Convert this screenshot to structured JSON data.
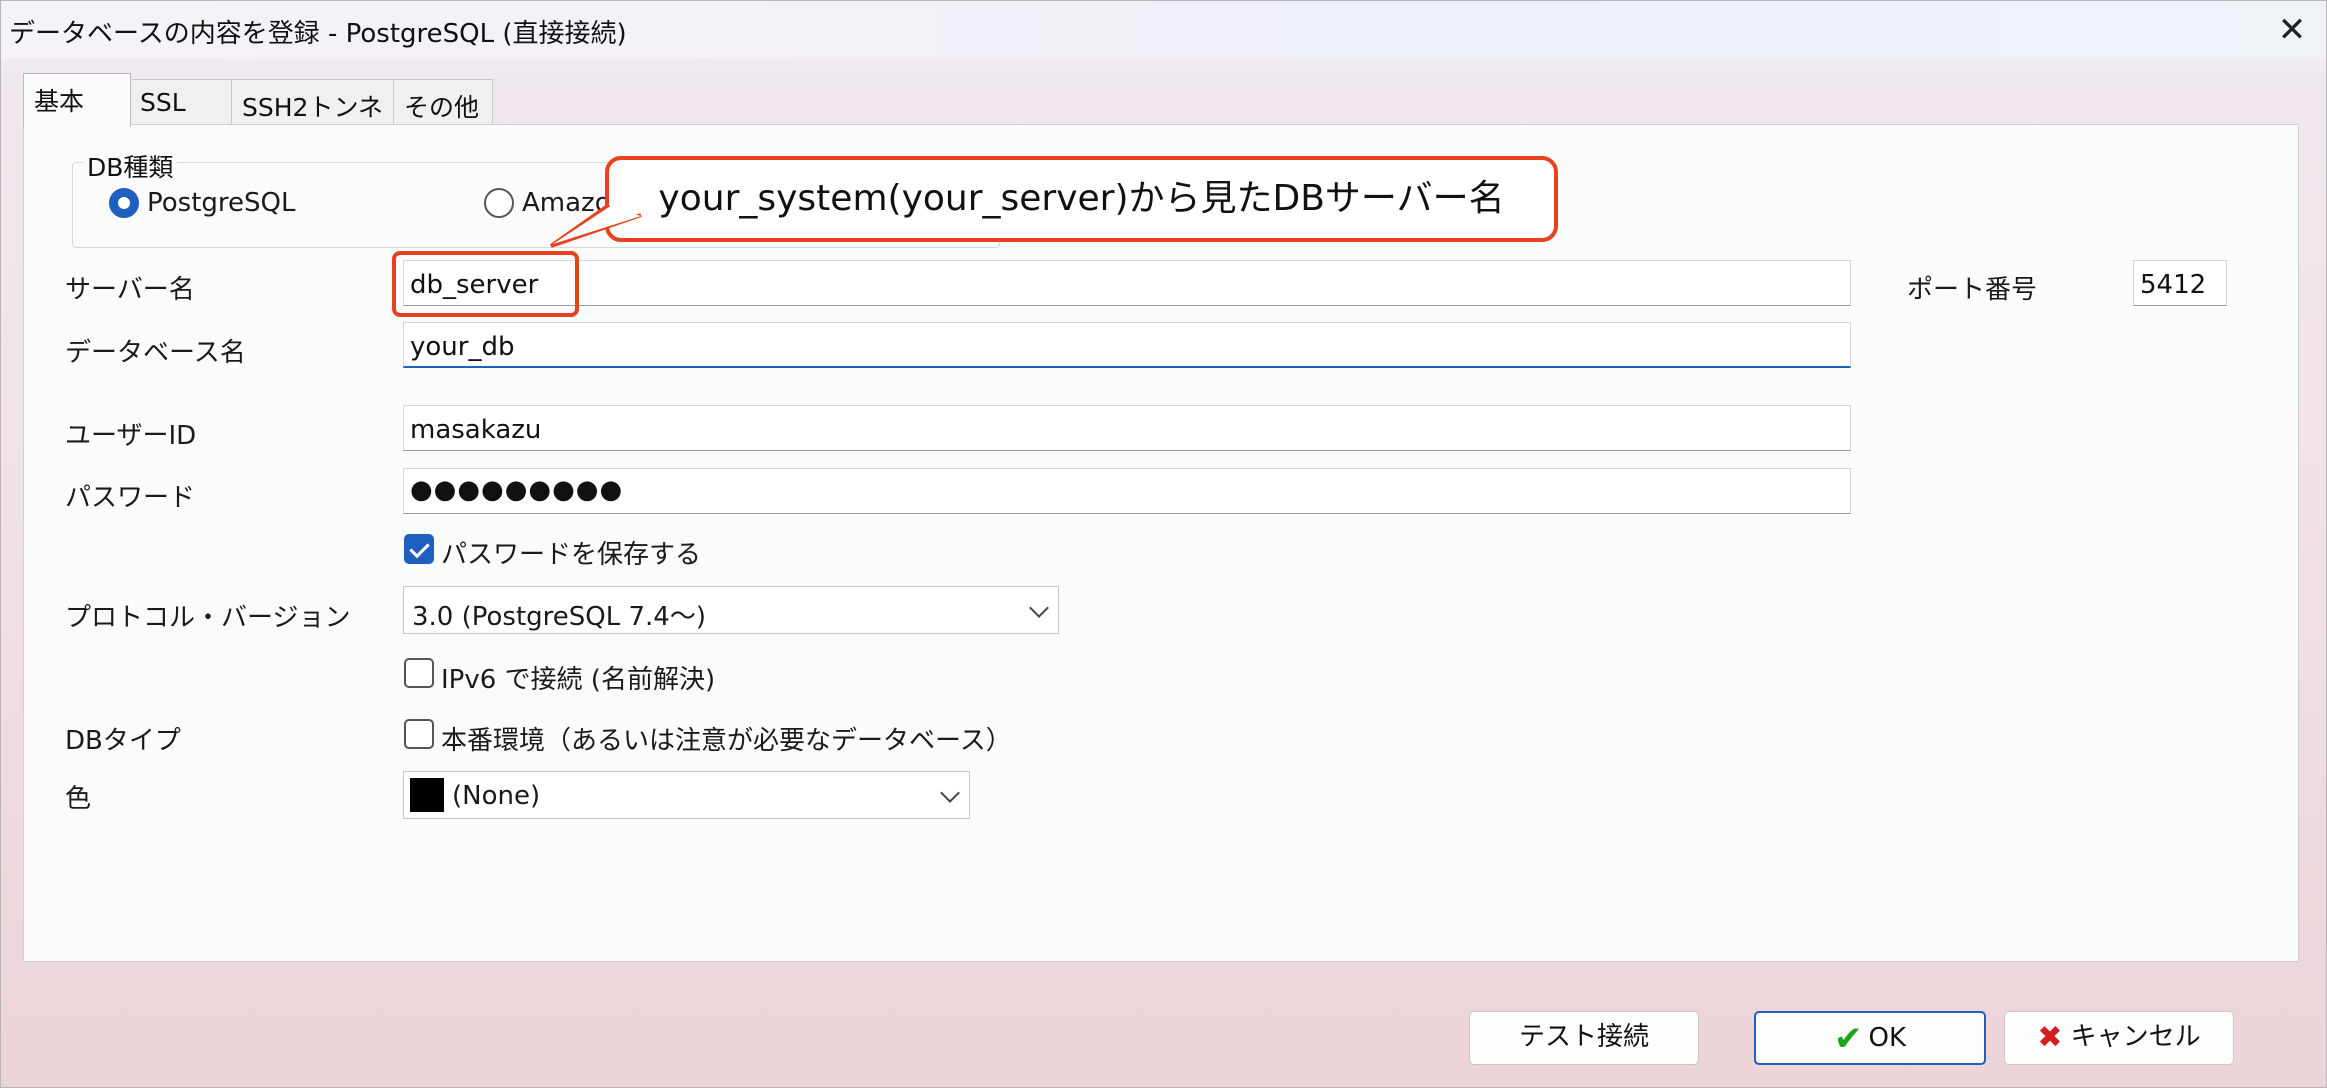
{
  "window": {
    "title": "データベースの内容を登録 - PostgreSQL (直接接続)",
    "close_icon": "close-icon"
  },
  "tabs": [
    {
      "label": "基本",
      "active": true
    },
    {
      "label": "SSL",
      "active": false
    },
    {
      "label": "SSH2トンネル",
      "active": false
    },
    {
      "label": "その他",
      "active": false
    }
  ],
  "db_type_group": {
    "legend": "DB種類",
    "options": [
      {
        "label": "PostgreSQL",
        "selected": true
      },
      {
        "label": "Amazo",
        "selected": false
      }
    ]
  },
  "callout": {
    "text": "your_system(your_server)から見たDBサーバー名"
  },
  "form": {
    "server_label": "サーバー名",
    "server_value": "db_server",
    "port_label": "ポート番号",
    "port_value": "5412",
    "database_label": "データベース名",
    "database_value": "your_db",
    "user_label": "ユーザーID",
    "user_value": "masakazu",
    "password_label": "パスワード",
    "password_value": "●●●●●●●●●",
    "save_password_label": "パスワードを保存する",
    "save_password_checked": true,
    "protocol_label": "プロトコル・バージョン",
    "protocol_value": "3.0  (PostgreSQL 7.4〜)",
    "ipv6_label": "IPv6 で接続 (名前解決)",
    "ipv6_checked": false,
    "dbtype_label": "DBタイプ",
    "production_label": "本番環境（あるいは注意が必要なデータベース）",
    "production_checked": false,
    "color_label": "色",
    "color_value": "(None)",
    "color_swatch": "#000000"
  },
  "buttons": {
    "test_label": "テスト接続",
    "ok_label": "OK",
    "cancel_label": "キャンセル"
  },
  "colors": {
    "accent": "#1f5fbf",
    "callout_border": "#e8411e"
  }
}
